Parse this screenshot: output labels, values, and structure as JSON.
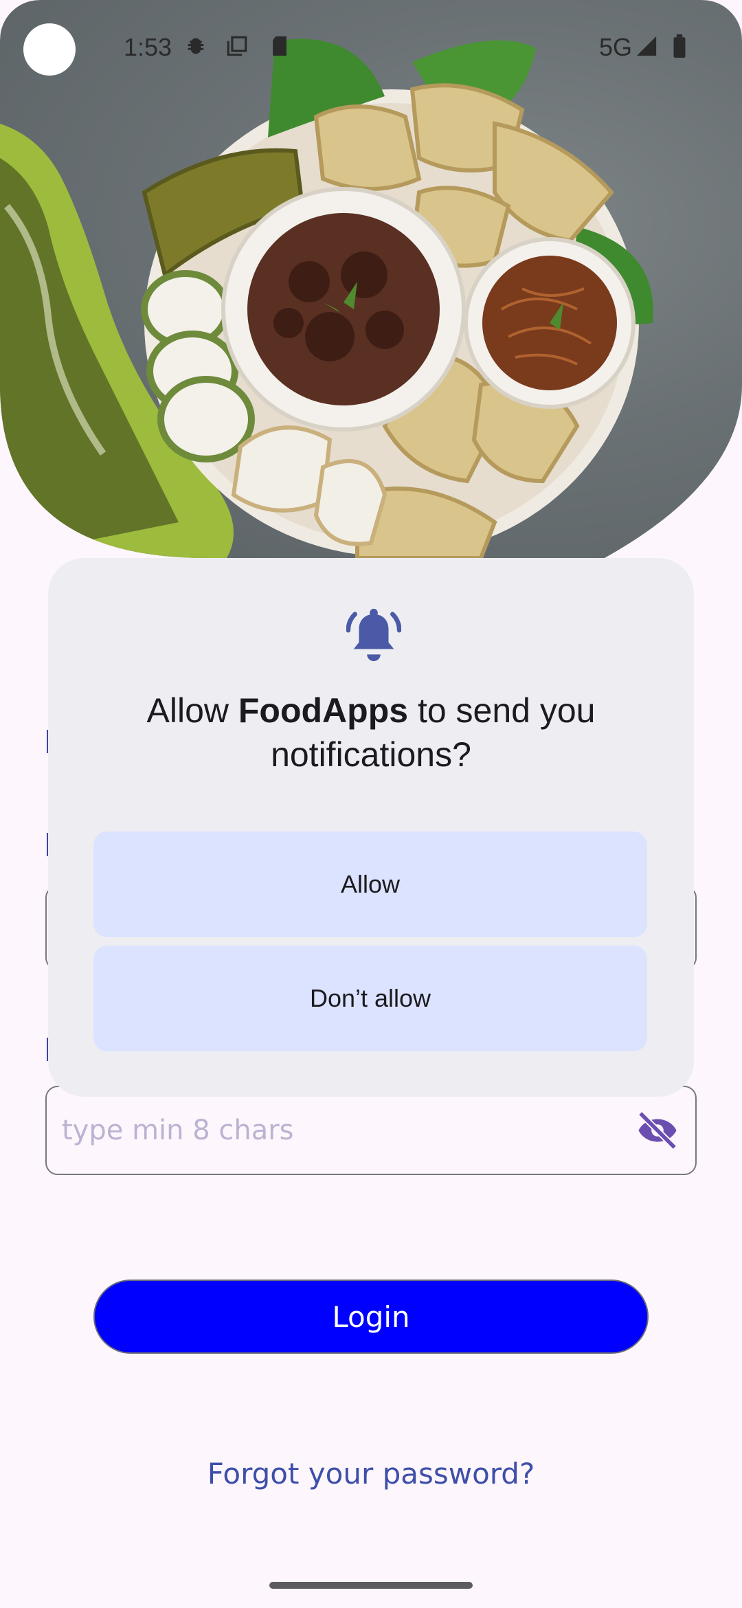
{
  "status_bar": {
    "time": "1:53",
    "network": "5G",
    "icons": [
      "camera-cutout",
      "bug-icon",
      "copy-icon",
      "sd-card-icon",
      "signal-icon",
      "battery-icon"
    ]
  },
  "hero": {
    "description_icon": "food-photo"
  },
  "form": {
    "password_placeholder": "type min 8 chars",
    "password_toggle_icon": "eye-off-icon",
    "login_label": "Login",
    "forgot_label": "Forgot your password?"
  },
  "dialog": {
    "icon": "bell-icon",
    "title_prefix": "Allow ",
    "app_name": "FoodApps",
    "title_suffix": " to send you notifications?",
    "allow_label": "Allow",
    "deny_label": "Don’t allow"
  },
  "colors": {
    "background": "#fdf6fc",
    "dialog_bg": "#eeeef2",
    "dialog_button_bg": "#dce3fe",
    "login_button": "#0000ff",
    "link": "#3d4fa8",
    "icon_accent": "#4a5aa6"
  }
}
